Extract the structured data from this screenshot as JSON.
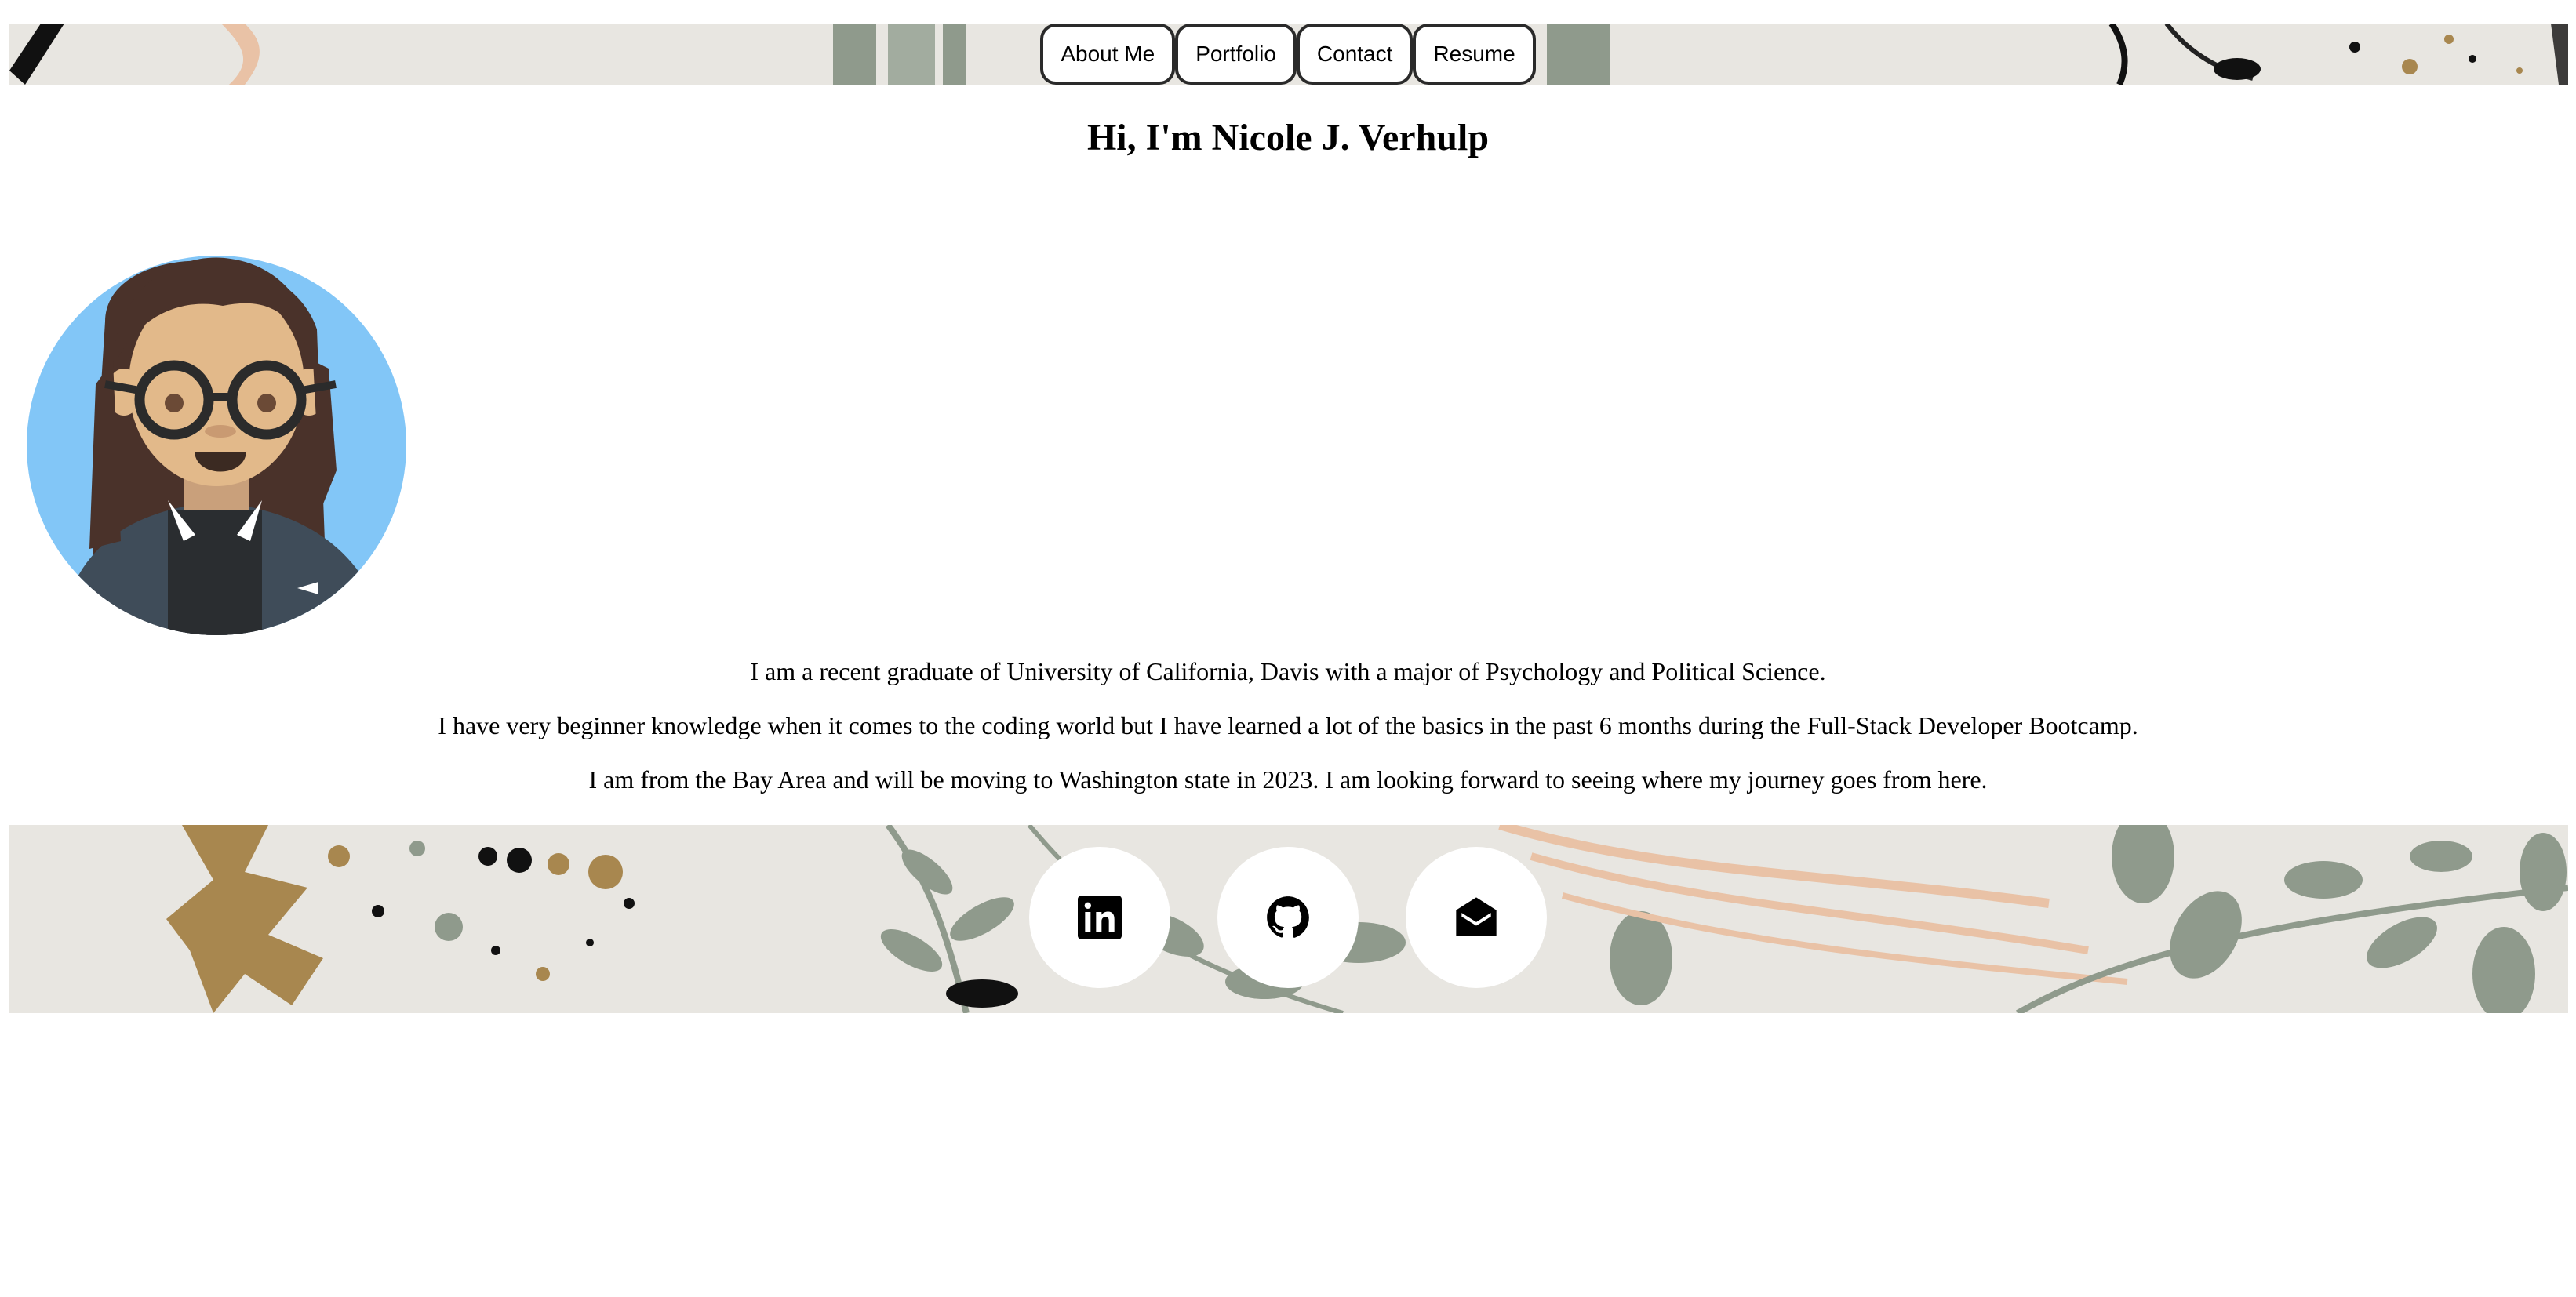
{
  "nav": {
    "items": [
      {
        "label": "About Me"
      },
      {
        "label": "Portfolio"
      },
      {
        "label": "Contact"
      },
      {
        "label": "Resume"
      }
    ]
  },
  "hero": {
    "title": "Hi, I'm Nicole J. Verhulp",
    "avatar_icon": "avatar-illustration"
  },
  "bio": {
    "paragraphs": [
      "I am a recent graduate of University of California, Davis with a major of Psychology and Political Science.",
      "I have very beginner knowledge when it comes to the coding world but I have learned a lot of the basics in the past 6 months during the Full-Stack Developer Bootcamp.",
      "I am from the Bay Area and will be moving to Washington state in 2023. I am looking forward to seeing where my journey goes from here."
    ]
  },
  "footer": {
    "socials": [
      {
        "icon": "linkedin-icon"
      },
      {
        "icon": "github-icon"
      },
      {
        "icon": "envelope-open-icon"
      }
    ]
  },
  "colors": {
    "banner_bg": "#e8e6e1",
    "leaf_green": "#8f9a8c",
    "peach": "#e9c2a6",
    "gold": "#a8874f",
    "avatar_bg": "#82c6f7"
  }
}
